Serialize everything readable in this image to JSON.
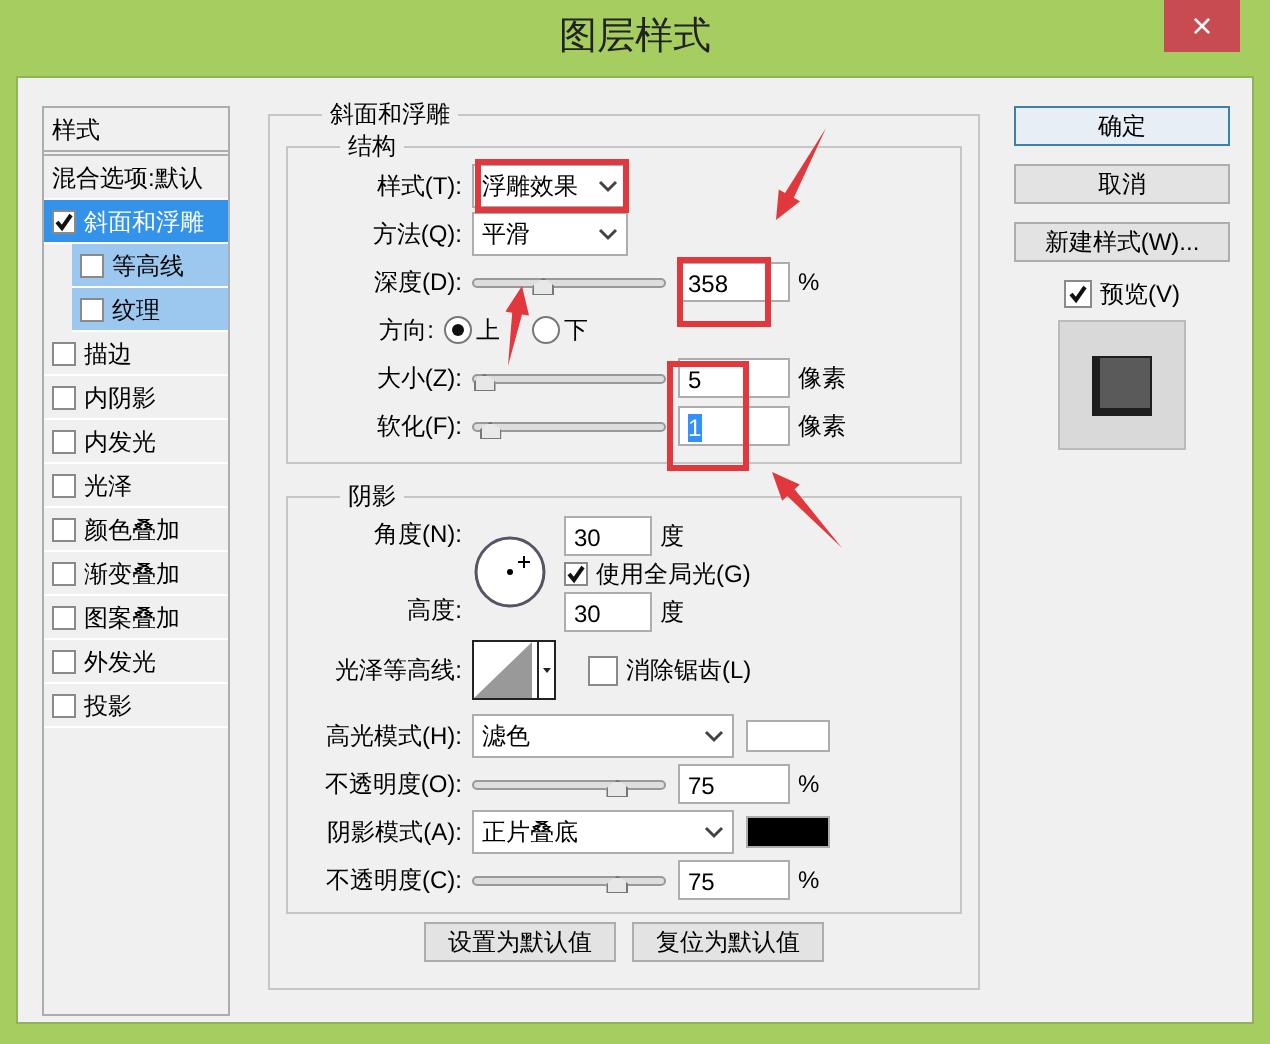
{
  "window": {
    "title": "图层样式",
    "close": "×"
  },
  "styles_list": {
    "header": "样式",
    "items": [
      {
        "label": "混合选项:默认",
        "kind": "plain",
        "selected": false
      },
      {
        "label": "斜面和浮雕",
        "kind": "check",
        "checked": true,
        "selected": true,
        "children": [
          {
            "label": "等高线",
            "kind": "check",
            "checked": false,
            "selected": false
          },
          {
            "label": "纹理",
            "kind": "check",
            "checked": false,
            "selected": false
          }
        ]
      },
      {
        "label": "描边",
        "kind": "check",
        "checked": false,
        "selected": false
      },
      {
        "label": "内阴影",
        "kind": "check",
        "checked": false,
        "selected": false
      },
      {
        "label": "内发光",
        "kind": "check",
        "checked": false,
        "selected": false
      },
      {
        "label": "光泽",
        "kind": "check",
        "checked": false,
        "selected": false
      },
      {
        "label": "颜色叠加",
        "kind": "check",
        "checked": false,
        "selected": false
      },
      {
        "label": "渐变叠加",
        "kind": "check",
        "checked": false,
        "selected": false
      },
      {
        "label": "图案叠加",
        "kind": "check",
        "checked": false,
        "selected": false
      },
      {
        "label": "外发光",
        "kind": "check",
        "checked": false,
        "selected": false
      },
      {
        "label": "投影",
        "kind": "check",
        "checked": false,
        "selected": false
      }
    ]
  },
  "bevel": {
    "title": "斜面和浮雕",
    "structure": {
      "title": "结构",
      "rows": [
        {
          "kind": "select",
          "label": "样式(T):",
          "value": "浮雕效果"
        },
        {
          "kind": "select",
          "label": "方法(Q):",
          "value": "平滑"
        },
        {
          "kind": "slider",
          "label": "深度(D):",
          "level": 0.36,
          "value": "358",
          "unit": "%"
        },
        {
          "kind": "radio",
          "label": "方向:",
          "options": [
            {
              "label": "上",
              "selected": true
            },
            {
              "label": "下",
              "selected": false
            }
          ]
        },
        {
          "kind": "slider",
          "label": "大小(Z):",
          "level": 0.05,
          "value": "5",
          "unit": "像素"
        },
        {
          "kind": "slider",
          "label": "软化(F):",
          "level": 0.08,
          "value": "1",
          "unit": "像素",
          "value_highlighted": true
        }
      ]
    },
    "shading": {
      "title": "阴影",
      "angle": {
        "label": "角度(N):",
        "value": "30",
        "unit": "度",
        "global_light": {
          "label": "使用全局光(G)",
          "checked": true
        }
      },
      "altitude": {
        "label": "高度:",
        "value": "30",
        "unit": "度"
      },
      "gloss_contour": {
        "label": "光泽等高线:",
        "anti_alias": {
          "label": "消除锯齿(L)",
          "checked": false
        }
      },
      "rows": [
        {
          "kind": "select",
          "label": "高光模式(H):",
          "value": "滤色",
          "color": "#ffffff"
        },
        {
          "kind": "slider",
          "label": "不透明度(O):",
          "level": 0.75,
          "value": "75",
          "unit": "%"
        },
        {
          "kind": "select",
          "label": "阴影模式(A):",
          "value": "正片叠底",
          "color": "#000000"
        },
        {
          "kind": "slider",
          "label": "不透明度(C):",
          "level": 0.75,
          "value": "75",
          "unit": "%"
        }
      ]
    },
    "buttons": [
      "设置为默认值",
      "复位为默认值"
    ]
  },
  "actions": {
    "buttons": [
      "确定",
      "取消",
      "新建样式(W)..."
    ],
    "preview": {
      "label": "预览(V)",
      "checked": true
    }
  }
}
